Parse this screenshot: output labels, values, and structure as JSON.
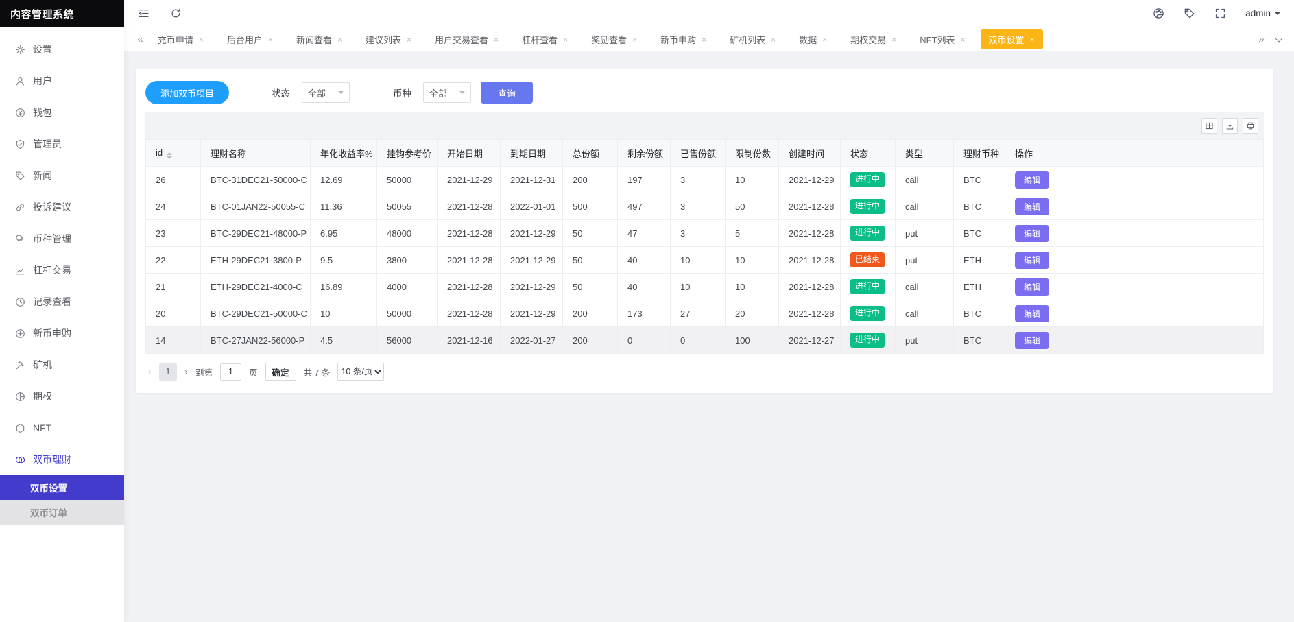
{
  "app": {
    "title": "内容管理系统"
  },
  "header": {
    "user": "admin"
  },
  "sidebar": {
    "items": [
      {
        "key": "settings",
        "label": "设置",
        "icon": "gear-icon"
      },
      {
        "key": "users",
        "label": "用户",
        "icon": "user-icon"
      },
      {
        "key": "wallet",
        "label": "钱包",
        "icon": "wallet-icon"
      },
      {
        "key": "admins",
        "label": "管理员",
        "icon": "shield-icon"
      },
      {
        "key": "news",
        "label": "新闻",
        "icon": "tag-icon"
      },
      {
        "key": "feedback",
        "label": "投诉建议",
        "icon": "link-icon"
      },
      {
        "key": "currency",
        "label": "币种管理",
        "icon": "coins-icon"
      },
      {
        "key": "leverage",
        "label": "杠杆交易",
        "icon": "chart-icon"
      },
      {
        "key": "records",
        "label": "记录查看",
        "icon": "clock-icon"
      },
      {
        "key": "new-coin",
        "label": "新币申购",
        "icon": "coin-plus-icon"
      },
      {
        "key": "miner",
        "label": "矿机",
        "icon": "pickaxe-icon"
      },
      {
        "key": "options",
        "label": "期权",
        "icon": "option-icon"
      },
      {
        "key": "nft",
        "label": "NFT",
        "icon": "hexagon-icon"
      },
      {
        "key": "dual-finance",
        "label": "双币理财",
        "icon": "dual-coin-icon",
        "active_parent": true
      }
    ],
    "subitems": [
      {
        "label": "双币设置",
        "active": true
      },
      {
        "label": "双币订单",
        "active": false
      }
    ]
  },
  "tabs": {
    "scroll_left": "«",
    "scroll_right": "»",
    "items": [
      "充币申请",
      "后台用户",
      "新闻查看",
      "建议列表",
      "用户交易查看",
      "杠杆查看",
      "奖励查看",
      "新币申购",
      "矿机列表",
      "数据",
      "期权交易",
      "NFT列表",
      "双币设置"
    ],
    "active_index": 12
  },
  "filters": {
    "add_button": "添加双币项目",
    "status_label": "状态",
    "status_value": "全部",
    "coin_label": "币种",
    "coin_value": "全部",
    "query_button": "查询"
  },
  "table": {
    "columns": [
      "id",
      "理财名称",
      "年化收益率%",
      "挂钩参考价",
      "开始日期",
      "到期日期",
      "总份额",
      "剩余份额",
      "已售份额",
      "限制份数",
      "创建时间",
      "状态",
      "类型",
      "理财币种",
      "操作"
    ],
    "edit_label": "编辑",
    "rows": [
      {
        "id": "26",
        "name": "BTC-31DEC21-50000-C",
        "rate": "12.69",
        "ref_price": "50000",
        "start": "2021-12-29",
        "end": "2021-12-31",
        "total": "200",
        "remaining": "197",
        "sold": "3",
        "limit": "10",
        "created": "2021-12-29",
        "status": "进行中",
        "status_key": "running",
        "type": "call",
        "coin": "BTC"
      },
      {
        "id": "24",
        "name": "BTC-01JAN22-50055-C",
        "rate": "11.36",
        "ref_price": "50055",
        "start": "2021-12-28",
        "end": "2022-01-01",
        "total": "500",
        "remaining": "497",
        "sold": "3",
        "limit": "50",
        "created": "2021-12-28",
        "status": "进行中",
        "status_key": "running",
        "type": "call",
        "coin": "BTC"
      },
      {
        "id": "23",
        "name": "BTC-29DEC21-48000-P",
        "rate": "6.95",
        "ref_price": "48000",
        "start": "2021-12-28",
        "end": "2021-12-29",
        "total": "50",
        "remaining": "47",
        "sold": "3",
        "limit": "5",
        "created": "2021-12-28",
        "status": "进行中",
        "status_key": "running",
        "type": "put",
        "coin": "BTC"
      },
      {
        "id": "22",
        "name": "ETH-29DEC21-3800-P",
        "rate": "9.5",
        "ref_price": "3800",
        "start": "2021-12-28",
        "end": "2021-12-29",
        "total": "50",
        "remaining": "40",
        "sold": "10",
        "limit": "10",
        "created": "2021-12-28",
        "status": "已结束",
        "status_key": "ended",
        "type": "put",
        "coin": "ETH"
      },
      {
        "id": "21",
        "name": "ETH-29DEC21-4000-C",
        "rate": "16.89",
        "ref_price": "4000",
        "start": "2021-12-28",
        "end": "2021-12-29",
        "total": "50",
        "remaining": "40",
        "sold": "10",
        "limit": "10",
        "created": "2021-12-28",
        "status": "进行中",
        "status_key": "running",
        "type": "call",
        "coin": "ETH"
      },
      {
        "id": "20",
        "name": "BTC-29DEC21-50000-C",
        "rate": "10",
        "ref_price": "50000",
        "start": "2021-12-28",
        "end": "2021-12-29",
        "total": "200",
        "remaining": "173",
        "sold": "27",
        "limit": "20",
        "created": "2021-12-28",
        "status": "进行中",
        "status_key": "running",
        "type": "call",
        "coin": "BTC"
      },
      {
        "id": "14",
        "name": "BTC-27JAN22-56000-P",
        "rate": "4.5",
        "ref_price": "56000",
        "start": "2021-12-16",
        "end": "2022-01-27",
        "total": "200",
        "remaining": "0",
        "sold": "0",
        "limit": "100",
        "created": "2021-12-27",
        "status": "进行中",
        "status_key": "running",
        "type": "put",
        "coin": "BTC",
        "highlighted": true
      }
    ]
  },
  "pagination": {
    "prev": "‹",
    "page": "1",
    "next": "›",
    "goto_label": "到第",
    "goto_value": "1",
    "page_unit": "页",
    "confirm_label": "确定",
    "total_label": "共 7 条",
    "page_size": "10 条/页"
  },
  "colors": {
    "primary_blue": "#1e9fff",
    "query_purple": "#6777ef",
    "edit_purple": "#7a6df0",
    "active_tab_yellow": "#fbb517",
    "sidebar_active": "#433bcb",
    "status_running": "#0bbd87",
    "status_ended": "#f2571c",
    "content_bg": "#f0f2f5",
    "logo_bg": "#0b0b0e"
  }
}
